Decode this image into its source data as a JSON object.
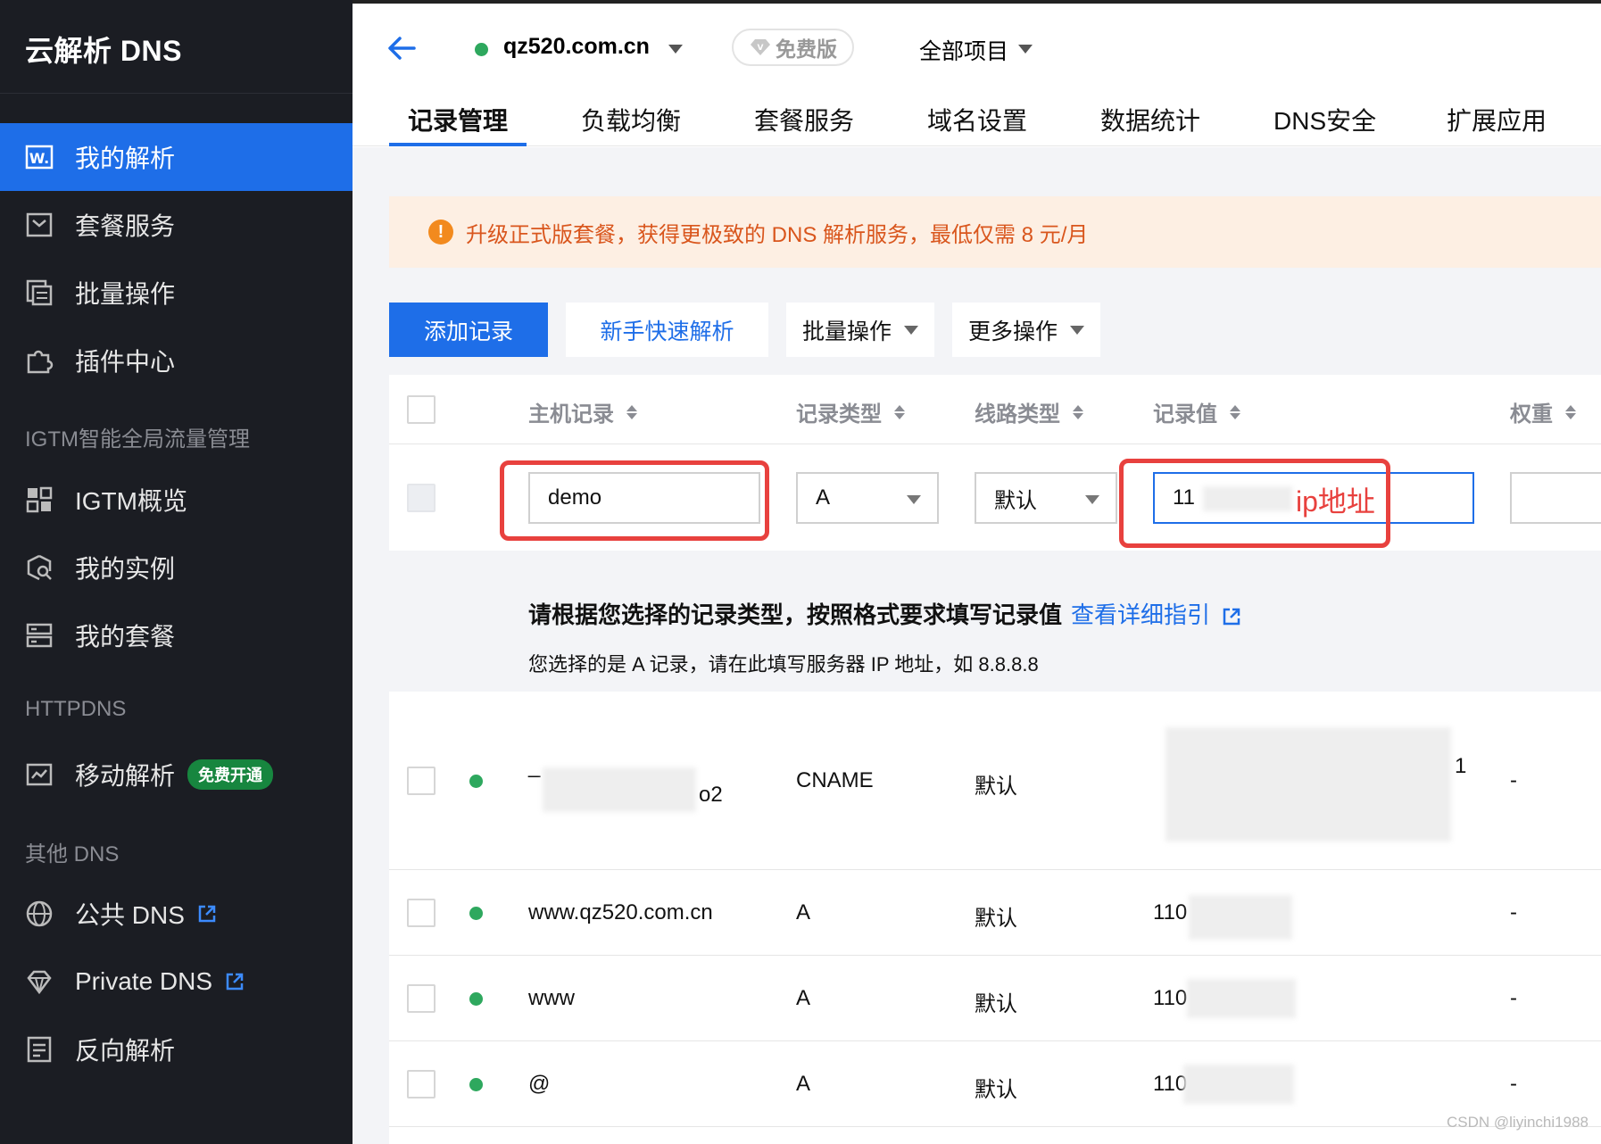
{
  "sidebar": {
    "brand": "云解析 DNS",
    "items_main": [
      {
        "label": "我的解析"
      },
      {
        "label": "套餐服务"
      },
      {
        "label": "批量操作"
      },
      {
        "label": "插件中心"
      }
    ],
    "section_igtm": "IGTM智能全局流量管理",
    "items_igtm": [
      {
        "label": "IGTM概览"
      },
      {
        "label": "我的实例"
      },
      {
        "label": "我的套餐"
      }
    ],
    "section_httpdns": "HTTPDNS",
    "mobile_label": "移动解析",
    "mobile_badge": "免费开通",
    "section_other": "其他 DNS",
    "public_dns": "公共 DNS",
    "private_dns": "Private DNS",
    "reverse": "反向解析"
  },
  "header": {
    "domain": "qz520.com.cn",
    "plan": "免费版",
    "project": "全部项目"
  },
  "tabs": [
    "记录管理",
    "负载均衡",
    "套餐服务",
    "域名设置",
    "数据统计",
    "DNS安全",
    "扩展应用"
  ],
  "notice": "升级正式版套餐，获得更极致的 DNS 解析服务，最低仅需 8 元/月",
  "toolbar": {
    "add": "添加记录",
    "quick": "新手快速解析",
    "batch": "批量操作",
    "more": "更多操作"
  },
  "table": {
    "headers": {
      "host": "主机记录",
      "type": "记录类型",
      "line": "线路类型",
      "value": "记录值",
      "weight": "权重"
    },
    "edit": {
      "host": "demo",
      "type": "A",
      "line": "默认",
      "value": "11",
      "value_note": "ip地址"
    },
    "hint_title": "请根据您选择的记录类型，按照格式要求填写记录值",
    "hint_link": "查看详细指引",
    "hint_text": "您选择的是 A 记录，请在此填写服务器 IP 地址，如 8.8.8.8",
    "rows": [
      {
        "host_a": "_",
        "host_b": "o2",
        "type": "CNAME",
        "line": "默认",
        "value_a": "1",
        "weight": "-"
      },
      {
        "host": "www.qz520.com.cn",
        "type": "A",
        "line": "默认",
        "value": "110",
        "weight": "-"
      },
      {
        "host": "www",
        "type": "A",
        "line": "默认",
        "value": "110",
        "weight": "-"
      },
      {
        "host": "@",
        "type": "A",
        "line": "默认",
        "value": "110",
        "weight": "-"
      }
    ]
  },
  "watermark": "CSDN @liyinchi1988",
  "colors": {
    "accent": "#1e6ee8",
    "sidebar_bg": "#1b1d23",
    "notice_bg": "#fdefe3",
    "notice_text": "#d9561d",
    "status_ok": "#2ea85e",
    "annotation": "#e8413e"
  }
}
